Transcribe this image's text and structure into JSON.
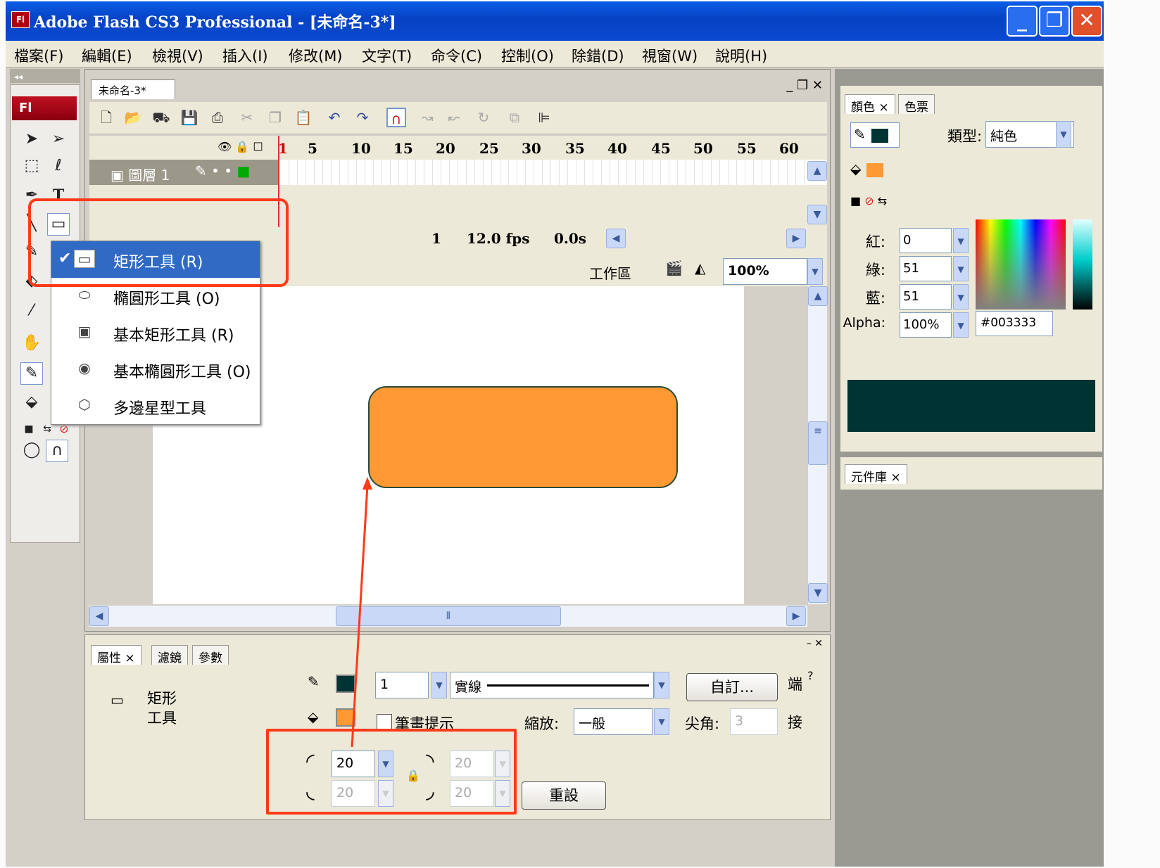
{
  "window": {
    "title": "Adobe Flash CS3 Professional - [未命名-3*]",
    "app_badge": "Fl"
  },
  "menu": [
    "檔案(F)",
    "編輯(E)",
    "檢視(V)",
    "插入(I)",
    "修改(M)",
    "文字(T)",
    "命令(C)",
    "控制(O)",
    "除錯(D)",
    "視窗(W)",
    "說明(H)"
  ],
  "toolbox": {
    "header": "Fl"
  },
  "document": {
    "tab": "未命名-3*",
    "timeline": {
      "ruler_numbers": [
        "1",
        "5",
        "10",
        "15",
        "20",
        "25",
        "30",
        "35",
        "40",
        "45",
        "50",
        "55",
        "60"
      ],
      "layer_name": "圖層 1",
      "current_frame": "1",
      "fps": "12.0 fps",
      "time": "0.0s"
    },
    "stagebar": {
      "workspace": "工作區",
      "zoom": "100%"
    },
    "shape": {
      "fill": "#ff9933",
      "stroke": "#2a4a3a"
    }
  },
  "popup_menu": {
    "items": [
      {
        "label": "矩形工具 (R)",
        "icon": "rectangle-icon",
        "selected": true
      },
      {
        "label": "橢圓形工具 (O)",
        "icon": "oval-icon",
        "selected": false
      },
      {
        "label": "基本矩形工具 (R)",
        "icon": "primitive-rectangle-icon",
        "selected": false
      },
      {
        "label": "基本橢圓形工具 (O)",
        "icon": "primitive-oval-icon",
        "selected": false
      },
      {
        "label": "多邊星型工具",
        "icon": "polystar-icon",
        "selected": false
      }
    ]
  },
  "properties": {
    "tabs": [
      "屬性",
      "濾鏡",
      "參數"
    ],
    "tool_name_line1": "矩形",
    "tool_name_line2": "工具",
    "stroke_width": "1",
    "stroke_style": "實線",
    "custom_button": "自訂...",
    "end_label": "端",
    "hinting_label": "筆畫提示",
    "scale_label": "縮放:",
    "scale_value": "一般",
    "miter_label": "尖角:",
    "miter_value": "3",
    "join_label": "接",
    "corner_radius": [
      "20",
      "20",
      "20",
      "20"
    ],
    "reset_button": "重設"
  },
  "color_panel": {
    "tabs": [
      "顏色",
      "色票"
    ],
    "type_label": "類型:",
    "type_value": "純色",
    "red_label": "紅:",
    "red": "0",
    "green_label": "綠:",
    "green": "51",
    "blue_label": "藍:",
    "blue": "51",
    "alpha_label": "Alpha:",
    "alpha": "100%",
    "hex": "#003333",
    "stroke_color": "#003333",
    "fill_color": "#ff9933"
  },
  "library_panel": {
    "tab": "元件庫"
  },
  "colors": {
    "highlight": "#ff3a1a",
    "selection": "#316ac5"
  }
}
